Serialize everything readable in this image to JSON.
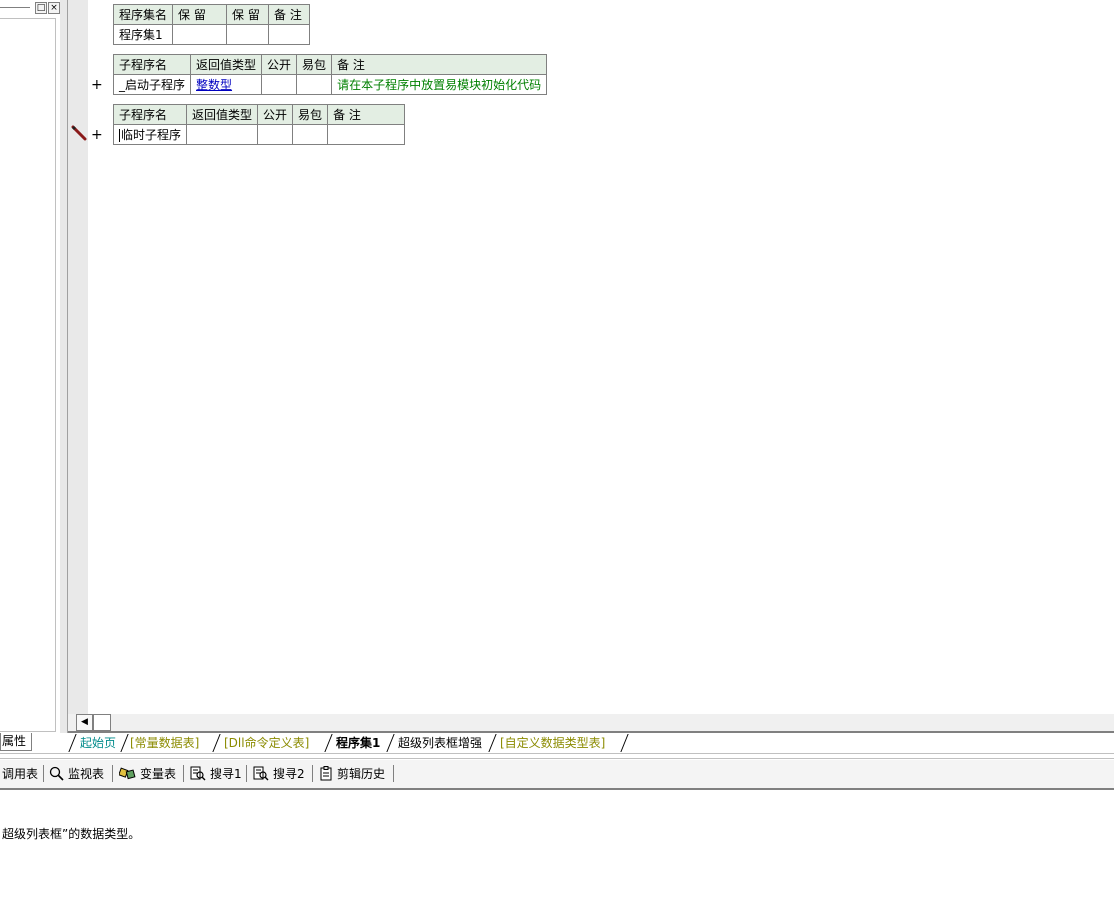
{
  "left_panel": {
    "window_buttons": {
      "restore": "□",
      "close": "×"
    },
    "property_tab_label": "属性"
  },
  "program_set_table": {
    "headers": [
      "程序集名",
      "保 留",
      "保 留",
      "备 注"
    ],
    "row": [
      "程序集1",
      "",
      "",
      ""
    ]
  },
  "sub_table_1": {
    "headers": [
      "子程序名",
      "返回值类型",
      "公开",
      "易包",
      "备 注"
    ],
    "row": {
      "name": "_启动子程序",
      "return_type": "整数型",
      "public": "",
      "epkg": "",
      "comment": "请在本子程序中放置易模块初始化代码"
    }
  },
  "sub_table_2": {
    "headers": [
      "子程序名",
      "返回值类型",
      "公开",
      "易包",
      "备 注"
    ],
    "row": {
      "name": "临时子程序",
      "return_type": "",
      "public": "",
      "epkg": "",
      "comment": ""
    }
  },
  "gutter": {
    "expand_symbol": "+"
  },
  "tabs": [
    {
      "label": "起始页",
      "style": "cyan"
    },
    {
      "label": "[常量数据表]",
      "style": "olive"
    },
    {
      "label": "[Dll命令定义表]",
      "style": "olive"
    },
    {
      "label": "程序集1",
      "style": "active"
    },
    {
      "label": "超级列表框增强",
      "style": "black"
    },
    {
      "label": "[自定义数据类型表]",
      "style": "olive"
    }
  ],
  "toolbar": {
    "items": [
      {
        "label": "调用表",
        "icon": ""
      },
      {
        "label": "监视表",
        "icon": "magnifier-icon"
      },
      {
        "label": "变量表",
        "icon": "variables-icon"
      },
      {
        "label": "搜寻1",
        "icon": "search-doc-icon"
      },
      {
        "label": "搜寻2",
        "icon": "search-doc-icon"
      },
      {
        "label": "剪辑历史",
        "icon": "clipboard-icon"
      }
    ]
  },
  "status": {
    "text": "超级列表框”的数据类型。"
  }
}
